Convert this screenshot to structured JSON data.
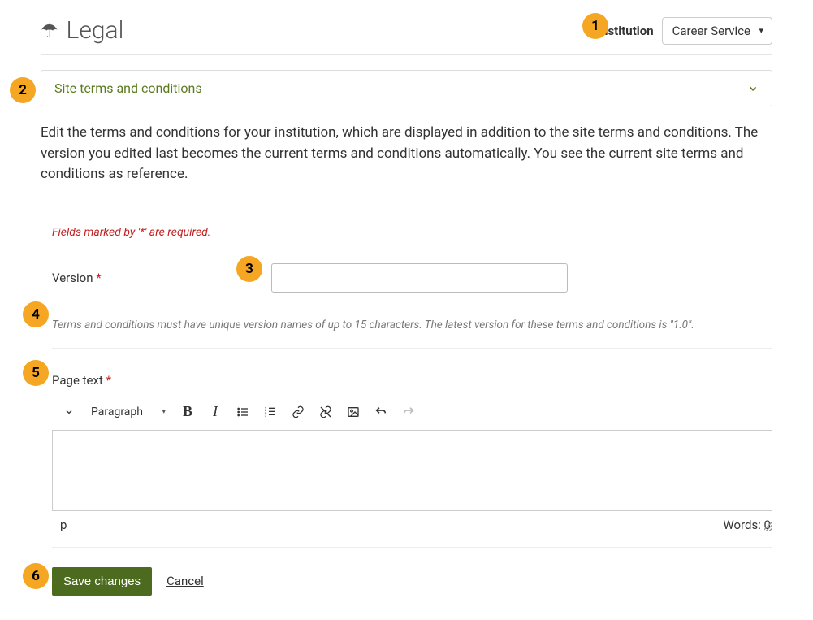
{
  "header": {
    "title": "Legal",
    "institution_label": "Institution",
    "institution_selected": "Career Service"
  },
  "accordion": {
    "title": "Site terms and conditions"
  },
  "intro": "Edit the terms and conditions for your institution, which are displayed in addition to the site terms and conditions. The version you edited last becomes the current terms and conditions automatically. You see the current site terms and conditions as reference.",
  "form": {
    "required_note": "Fields marked by '*' are required.",
    "version_label": "Version",
    "version_value": "",
    "version_help": "Terms and conditions must have unique version names of up to 15 characters. The latest version for these terms and conditions is \"1.0\".",
    "pagetext_label": "Page text"
  },
  "editor": {
    "paragraph_label": "Paragraph",
    "path_status": "p",
    "words_label": "Words: 0"
  },
  "actions": {
    "save": "Save changes",
    "cancel": "Cancel"
  },
  "callouts": {
    "c1": "1",
    "c2": "2",
    "c3": "3",
    "c4": "4",
    "c5": "5",
    "c6": "6"
  }
}
